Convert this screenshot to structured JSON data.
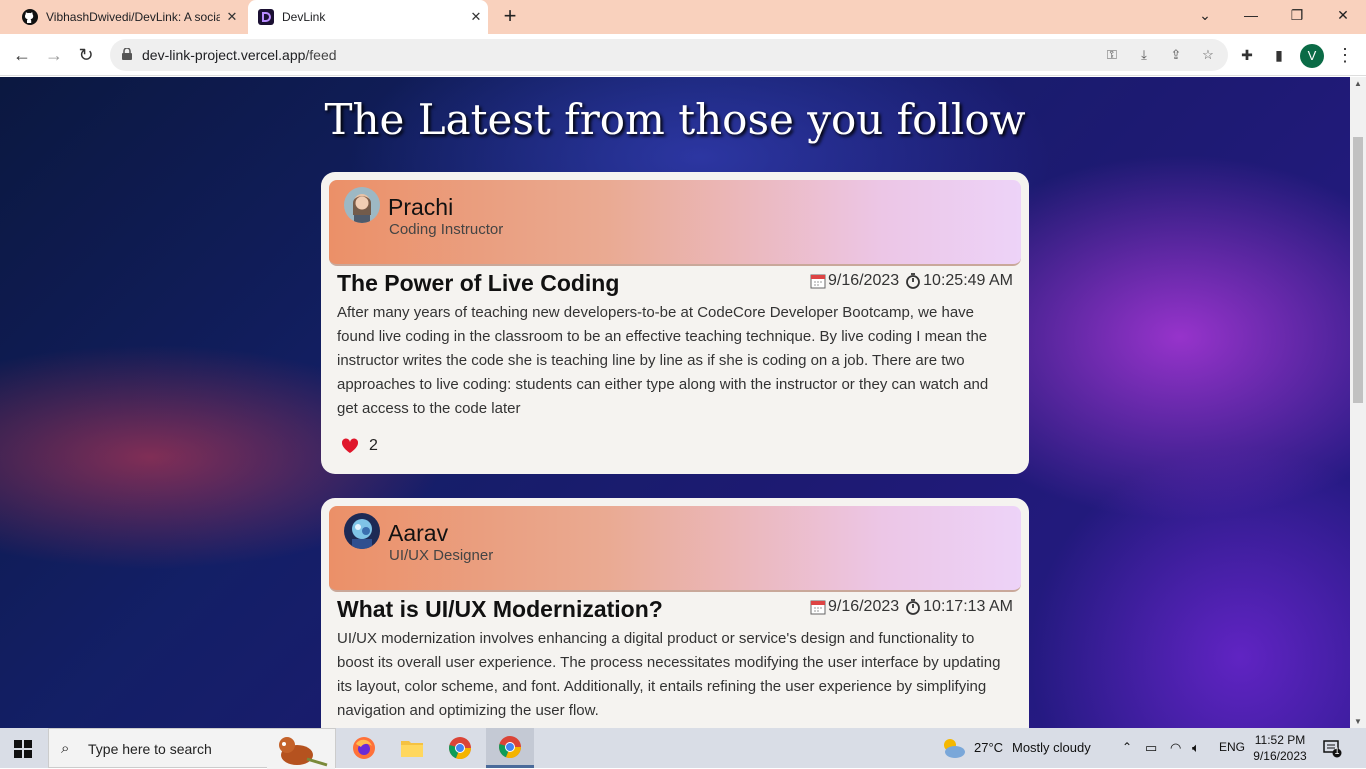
{
  "browser": {
    "tabs": [
      {
        "title": "VibhashDwivedi/DevLink: A social",
        "close": "✕"
      },
      {
        "title": "DevLink",
        "close": "✕"
      }
    ],
    "new_tab": "+",
    "url_domain": "dev-link-project.vercel.app",
    "url_path": "/feed",
    "profile_initial": "V"
  },
  "page": {
    "heading": "The Latest from those you follow",
    "posts": [
      {
        "author": "Prachi",
        "role": "Coding Instructor",
        "title": "The Power of Live Coding",
        "date": "9/16/2023",
        "time": "10:25:49 AM",
        "body": "After many years of teaching new developers-to-be at CodeCore Developer Bootcamp, we have found live coding in the classroom to be an effective teaching technique. By live coding I mean the instructor writes the code she is teaching line by line as if she is coding on a job. There are two approaches to live coding: students can either type along with the instructor or they can watch and get access to the code later",
        "likes": "2"
      },
      {
        "author": "Aarav",
        "role": "UI/UX Designer",
        "title": "What is UI/UX Modernization?",
        "date": "9/16/2023",
        "time": "10:17:13 AM",
        "body": "UI/UX modernization involves enhancing a digital product or service's design and functionality to boost its overall user experience. The process necessitates modifying the user interface by updating its layout, color scheme, and font. Additionally, it entails refining the user experience by simplifying navigation and optimizing the user flow."
      }
    ]
  },
  "taskbar": {
    "search_placeholder": "Type here to search",
    "weather_temp": "27°C",
    "weather_text": "Mostly cloudy",
    "language": "ENG",
    "time": "11:52 PM",
    "date": "9/16/2023",
    "notification_count": "1"
  },
  "colors": {
    "tabbar": "#f9d1bd",
    "card_header_start": "#eb9068",
    "card_header_end": "#edd3f8",
    "heart": "#e0162b"
  }
}
